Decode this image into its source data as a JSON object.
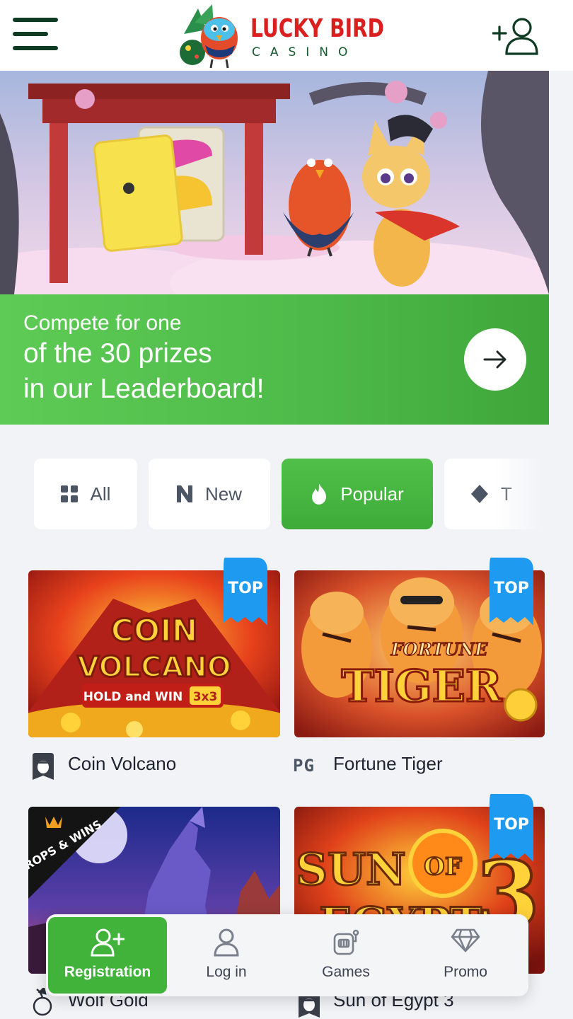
{
  "header": {
    "logo_title": "LUCKY BIRD",
    "logo_subtitle": "CASINO",
    "menu_icon": "hamburger-icon",
    "account_icon": "user-add-icon"
  },
  "promo": {
    "line1": "Compete for one",
    "line2": "of the 30 prizes",
    "line3": "in our Leaderboard!",
    "arrow_icon": "arrow-right-icon"
  },
  "tabs": [
    {
      "label": "All",
      "icon": "grid-icon",
      "active": false
    },
    {
      "label": "New",
      "icon": "new-n-icon",
      "active": false
    },
    {
      "label": "Popular",
      "icon": "flame-icon",
      "active": true
    },
    {
      "label": "T",
      "icon": "diamond-icon",
      "active": false
    }
  ],
  "games": [
    {
      "name": "Coin Volcano",
      "badge": "TOP",
      "provider_icon": "acorn-shield-icon",
      "art_title": "COIN",
      "art_title2": "VOLCANO",
      "art_caption": "HOLD and WIN",
      "art_caption2": "3x3"
    },
    {
      "name": "Fortune Tiger",
      "badge": "TOP",
      "provider_label": "PG",
      "art_title": "FORTUNE",
      "art_title2": "TIGER"
    },
    {
      "name": "Wolf Gold",
      "badge": "",
      "ribbon": "DROPS & WINS",
      "provider_icon": "cherry-icon"
    },
    {
      "name": "Sun of Egypt 3",
      "badge": "TOP",
      "provider_icon": "acorn-shield-icon",
      "art_title": "SUN",
      "art_of": "OF",
      "art_title2": "EGYPT",
      "art_num": "3"
    }
  ],
  "bottom_nav": [
    {
      "label": "Registration",
      "icon": "add-user-icon"
    },
    {
      "label": "Log in",
      "icon": "user-icon"
    },
    {
      "label": "Games",
      "icon": "slot-machine-icon"
    },
    {
      "label": "Promo",
      "icon": "diamond-icon"
    }
  ],
  "colors": {
    "brand_green": "#41b33b",
    "header_dark_green": "#0e3b22",
    "logo_red": "#d9201f",
    "top_badge_blue": "#1e9bf0",
    "page_bg": "#f2f3f7"
  }
}
